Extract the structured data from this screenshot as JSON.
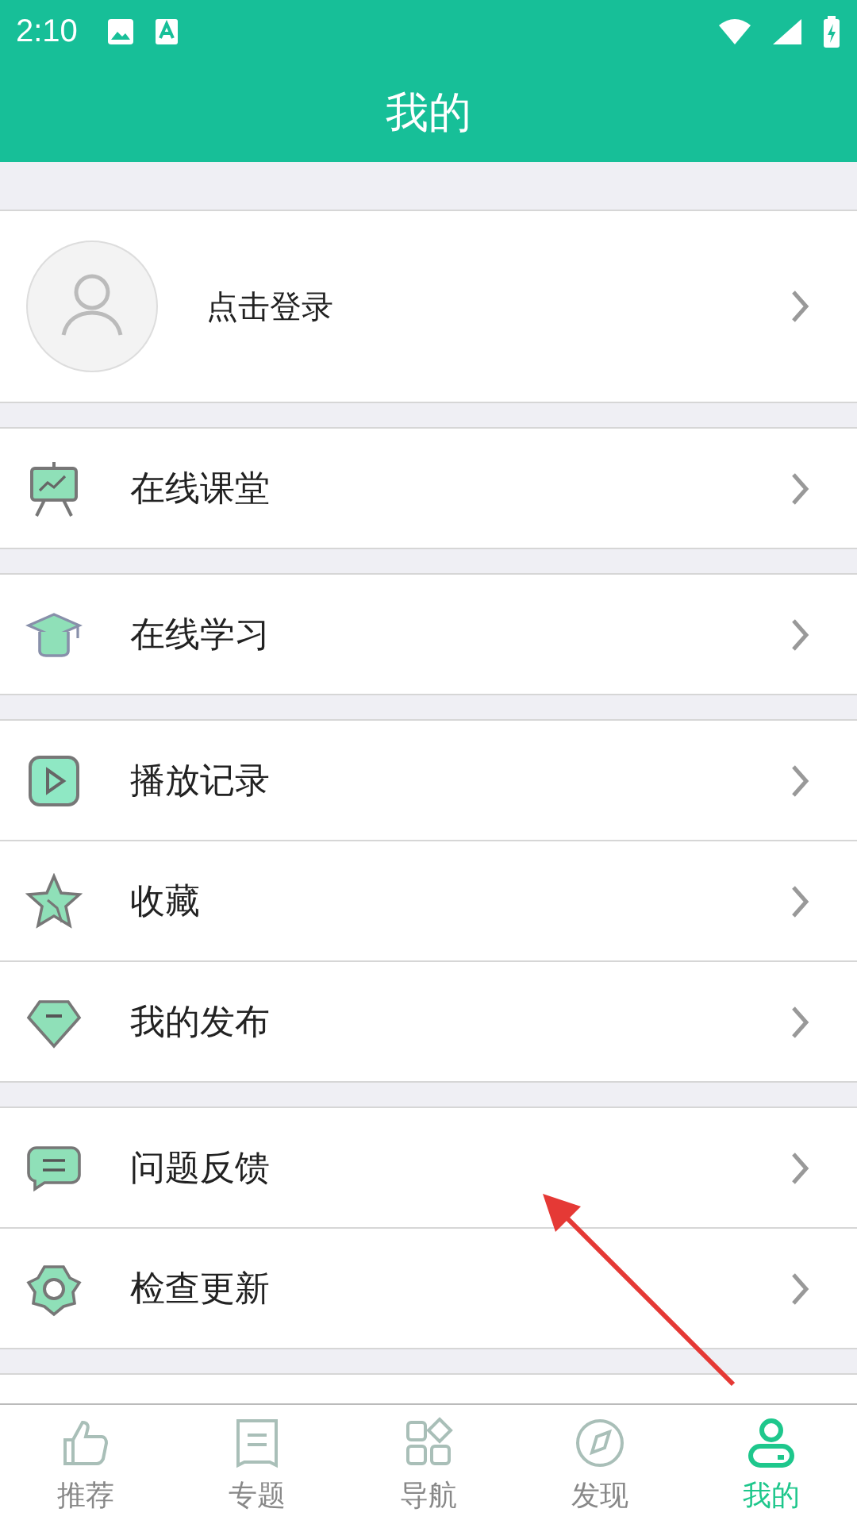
{
  "status_bar": {
    "time": "2:10"
  },
  "header": {
    "title": "我的"
  },
  "profile": {
    "label": "点击登录"
  },
  "groups": [
    {
      "items": [
        {
          "label": "在线课堂"
        }
      ]
    },
    {
      "items": [
        {
          "label": "在线学习"
        }
      ]
    },
    {
      "items": [
        {
          "label": "播放记录"
        },
        {
          "label": "收藏"
        },
        {
          "label": "我的发布"
        }
      ]
    },
    {
      "items": [
        {
          "label": "问题反馈"
        },
        {
          "label": "检查更新"
        }
      ]
    }
  ],
  "tabs": [
    {
      "label": "推荐",
      "selected": false
    },
    {
      "label": "专题",
      "selected": false
    },
    {
      "label": "导航",
      "selected": false
    },
    {
      "label": "发现",
      "selected": false
    },
    {
      "label": "我的",
      "selected": true
    }
  ]
}
